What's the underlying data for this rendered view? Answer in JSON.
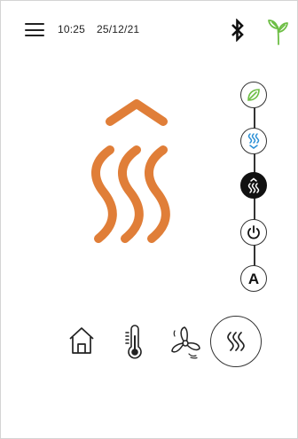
{
  "status_bar": {
    "time": "10:25",
    "date": "25/12/21",
    "icons": [
      "menu-icon",
      "bluetooth-icon",
      "eco-leaf-icon"
    ]
  },
  "main": {
    "graphic": "heat-waves-up-icon",
    "accent_color": "#E07E38"
  },
  "modes": [
    {
      "name": "eco",
      "icon": "leaf-icon",
      "active": false
    },
    {
      "name": "comfort-low",
      "icon": "heat-waves-down-icon",
      "active": false
    },
    {
      "name": "comfort-high",
      "icon": "heat-waves-up-icon",
      "active": true
    },
    {
      "name": "power",
      "icon": "power-icon",
      "active": false
    },
    {
      "name": "auto",
      "label": "A",
      "active": false
    }
  ],
  "bottom_nav": [
    {
      "name": "home",
      "icon": "home-icon",
      "active": false
    },
    {
      "name": "temperature",
      "icon": "thermometer-icon",
      "active": false
    },
    {
      "name": "fan",
      "icon": "fan-icon",
      "active": false
    },
    {
      "name": "heating",
      "icon": "heat-waves-icon",
      "active": true
    }
  ],
  "colors": {
    "heat": "#E07E38",
    "eco_green": "#6DBE45",
    "comfort_blue": "#2A8FD6",
    "ink": "#222222"
  }
}
